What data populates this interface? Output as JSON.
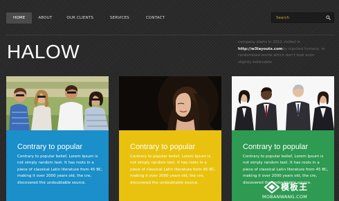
{
  "nav": {
    "items": [
      {
        "label": "HOME",
        "active": true
      },
      {
        "label": "ABOUT",
        "active": false
      },
      {
        "label": "OUR CLIENTS",
        "active": false
      },
      {
        "label": "SERVICES",
        "active": false
      },
      {
        "label": "CONTACT",
        "active": false
      }
    ]
  },
  "search": {
    "placeholder": "Search",
    "icon": "magnifier-icon"
  },
  "header": {
    "logo": "HALOW",
    "intro_before": "company starts in 2012 visited in ",
    "intro_url": "http://w3layouts.com",
    "intro_after": "by injected humour, or randomised words which don't look even slightly believable"
  },
  "cards": [
    {
      "title": "Contrary to popular",
      "text": "Contrary to popular belief, Lorem Ipsum is not simply random text. It has roots in a piece of classical Latin literature from 45 BC, making it over 2000 years old, the cre, discovered the undoubtable source.",
      "color": "#1a8fc9"
    },
    {
      "title": "Contrary to popular",
      "text": "Contrary to popular belief, Lorem Ipsum is not simply random text. It has roots in a piece of classical Latin literature from 45 BC, making it over 2000 years old, the cre, discovered the undoubtable source.",
      "color": "#e9c20f"
    },
    {
      "title": "Contrary to popular",
      "text": "Contrary to popular belief, Lorem Ipsum is not simply random text. It has roots in a piece of classical Latin literature from 45 BC, making it over 2000 years old, the cre, discovered the undoubtable source.",
      "color": "#2e9a52"
    }
  ],
  "watermark": {
    "text": "模板王",
    "sub": "MOBANWANG.COM"
  },
  "colors": {
    "background": "#2b2b2b",
    "nav_active": "#4a4a4a",
    "search_text": "#c9a23a"
  }
}
